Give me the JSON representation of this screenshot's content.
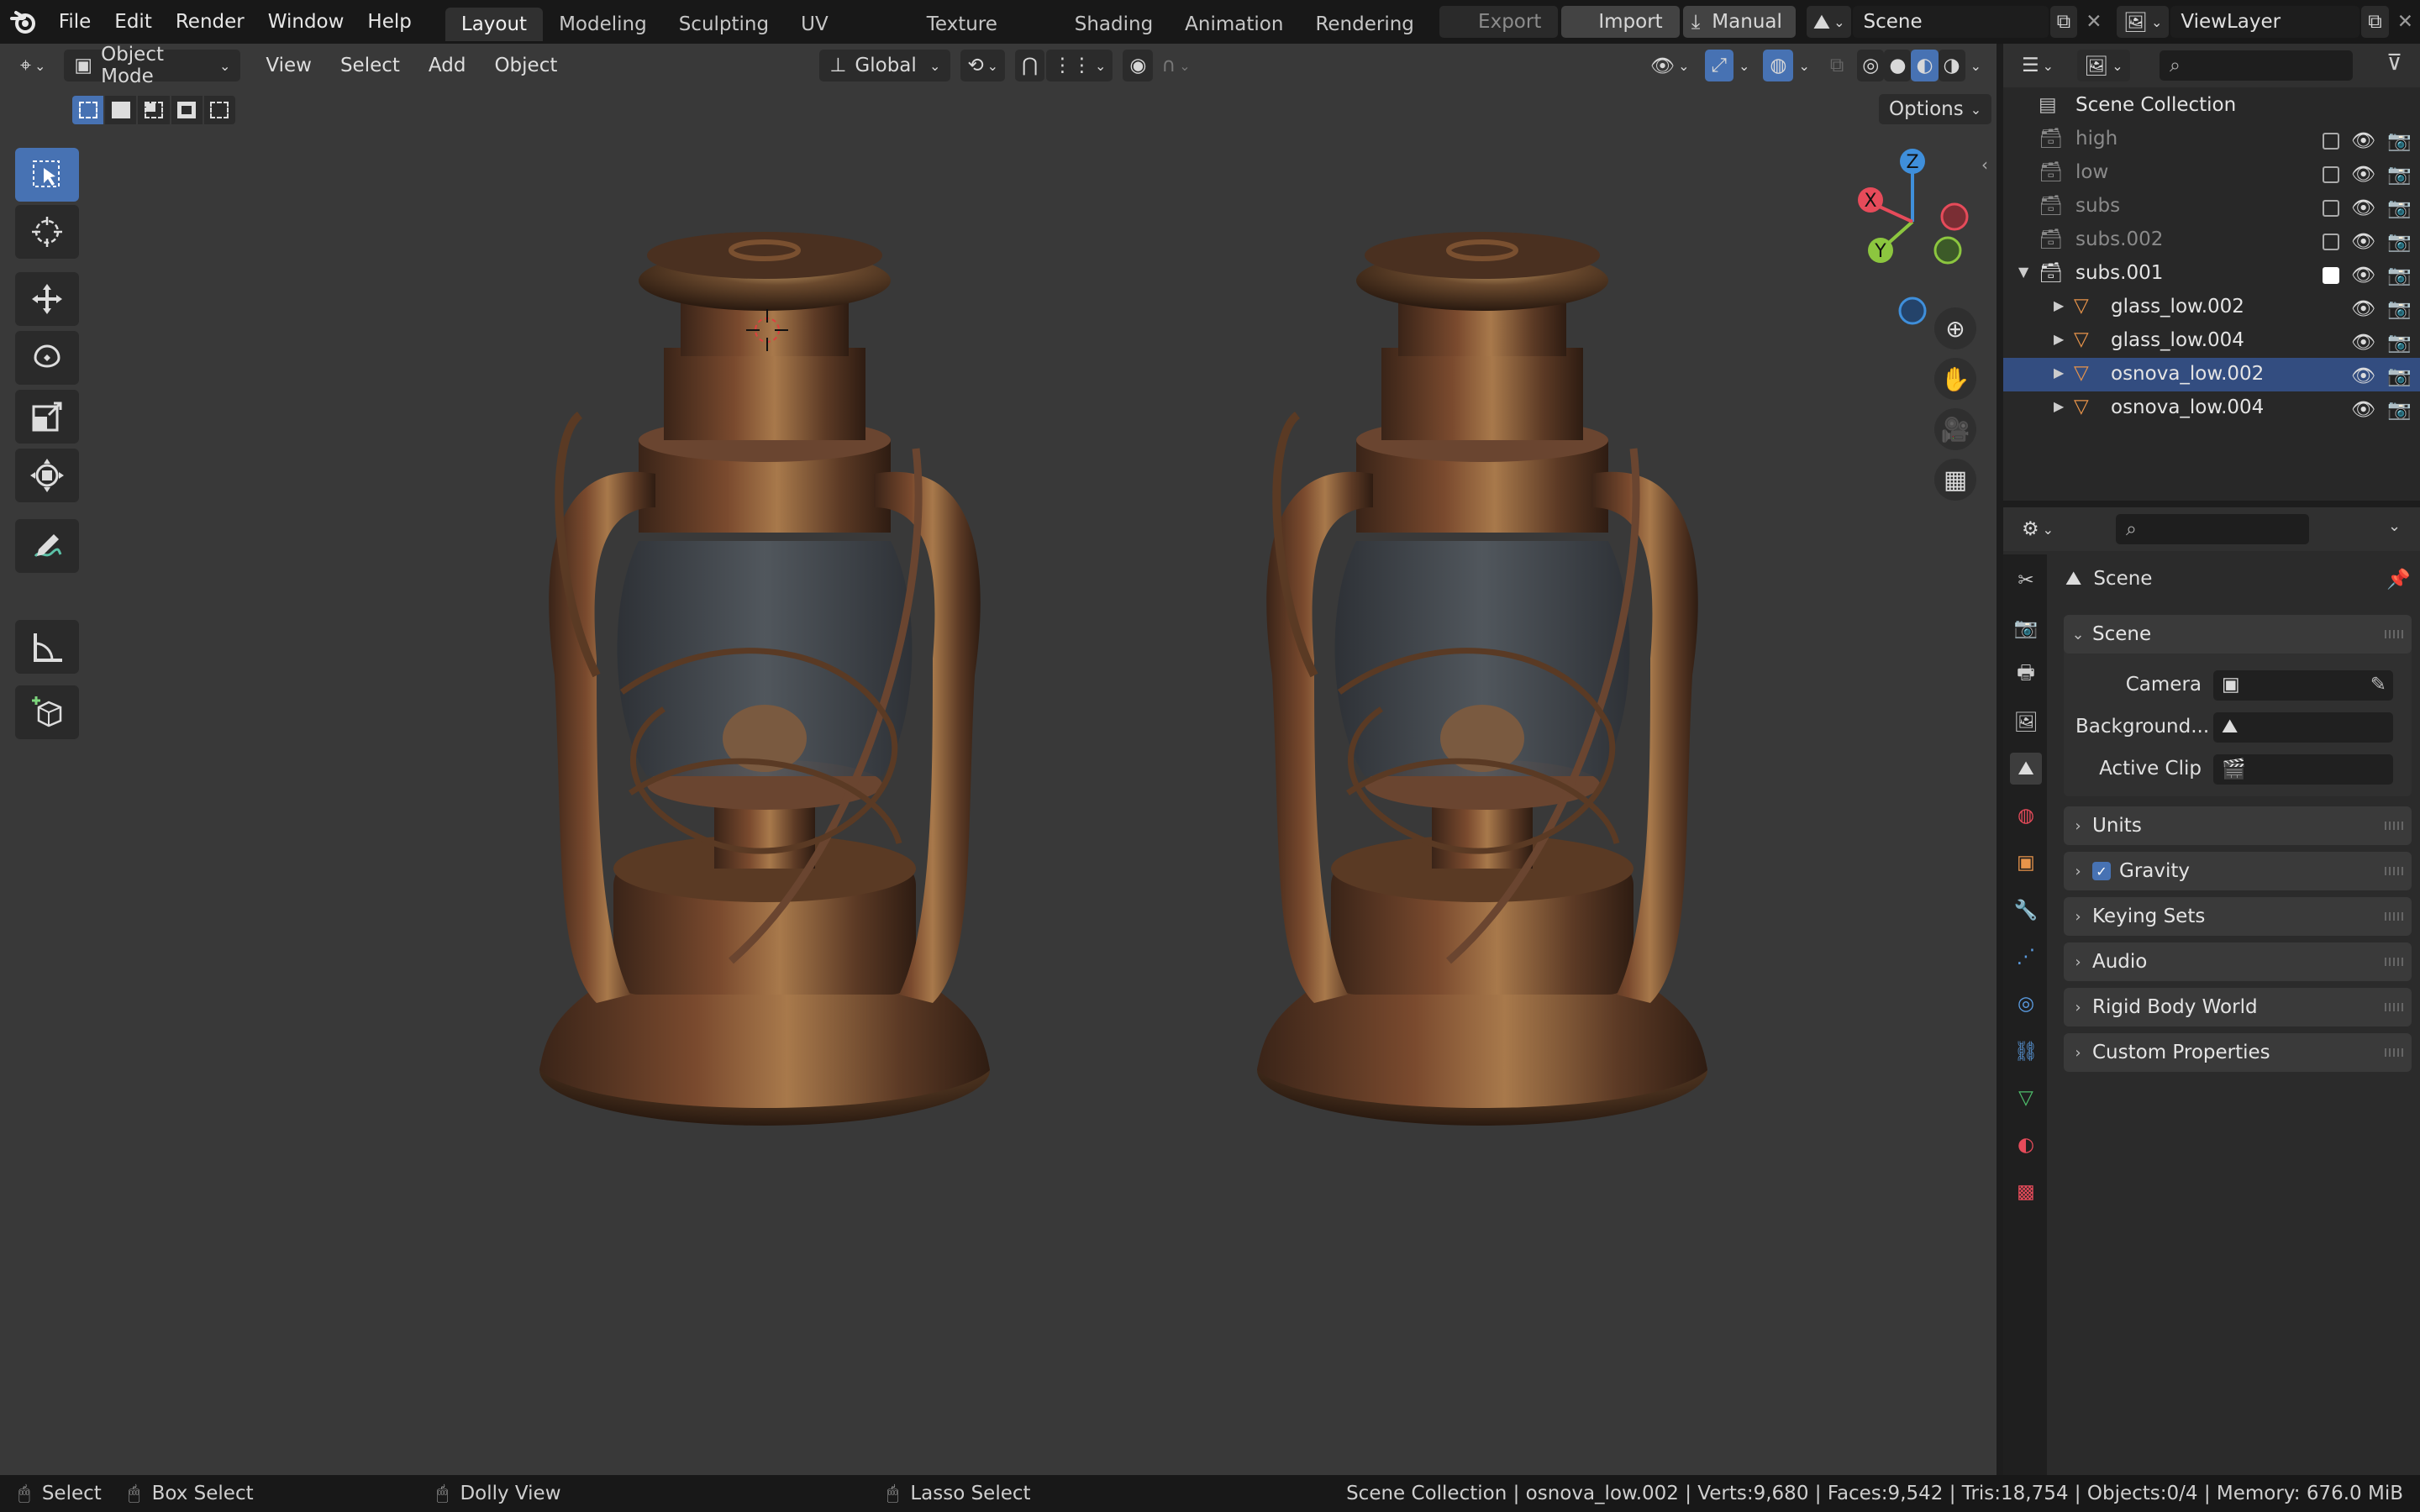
{
  "app": {
    "name": "Blender"
  },
  "menu": [
    "File",
    "Edit",
    "Render",
    "Window",
    "Help"
  ],
  "workspaces": [
    "Layout",
    "Modeling",
    "Sculpting",
    "UV Editing",
    "Texture Paint",
    "Shading",
    "Animation",
    "Rendering"
  ],
  "active_workspace": "Layout",
  "topbar": {
    "export_label": "Export",
    "import_label": "Import",
    "manual_label": "Manual",
    "scene_value": "Scene",
    "viewlayer_value": "ViewLayer"
  },
  "viewport_header": {
    "mode": "Object Mode",
    "menus": [
      "View",
      "Select",
      "Add",
      "Object"
    ],
    "orientation": "Global",
    "options_label": "Options"
  },
  "gizmo": {
    "x_label": "X",
    "y_label": "Y",
    "z_label": "Z"
  },
  "outliner": {
    "root": "Scene Collection",
    "items": [
      {
        "name": "high",
        "level": 0,
        "excluded": true,
        "expanded": false
      },
      {
        "name": "low",
        "level": 0,
        "excluded": true,
        "expanded": false
      },
      {
        "name": "subs",
        "level": 0,
        "excluded": true,
        "expanded": false
      },
      {
        "name": "subs.002",
        "level": 0,
        "excluded": true,
        "expanded": false
      },
      {
        "name": "subs.001",
        "level": 0,
        "excluded": false,
        "expanded": true
      },
      {
        "name": "glass_low.002",
        "level": 1,
        "type": "mesh"
      },
      {
        "name": "glass_low.004",
        "level": 1,
        "type": "mesh"
      },
      {
        "name": "osnova_low.002",
        "level": 1,
        "type": "mesh",
        "active": true
      },
      {
        "name": "osnova_low.004",
        "level": 1,
        "type": "mesh"
      }
    ]
  },
  "properties": {
    "context_title": "Scene",
    "scene_panel_title": "Scene",
    "camera_label": "Camera",
    "background_label": "Background...",
    "active_clip_label": "Active Clip",
    "panels": [
      "Units",
      "Gravity",
      "Keying Sets",
      "Audio",
      "Rigid Body World",
      "Custom Properties"
    ],
    "gravity_checked": true
  },
  "statusbar": {
    "select": "Select",
    "box_select": "Box Select",
    "dolly_view": "Dolly View",
    "lasso_select": "Lasso Select",
    "stats": "Scene Collection | osnova_low.002 | Verts:9,680 | Faces:9,542 | Tris:18,754 | Objects:0/4 | Memory: 676.0 MiB"
  },
  "colors": {
    "accent": "#4772b3",
    "mesh_icon": "#e8944a",
    "viewport_bg": "#393939",
    "x_axis": "#e64b5a",
    "y_axis": "#8cc63f",
    "z_axis": "#3f8fdb"
  }
}
